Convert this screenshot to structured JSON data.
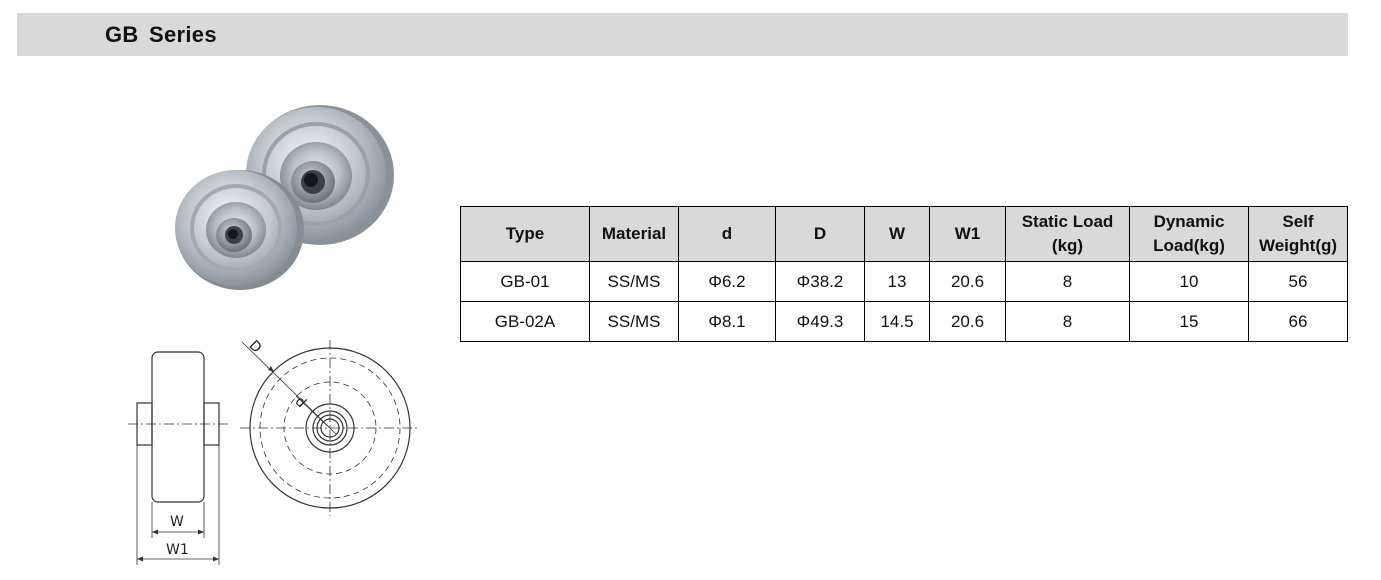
{
  "header": {
    "title": "GB  Series"
  },
  "drawing_labels": {
    "outer_diameter": "D",
    "bore": "d",
    "width": "W",
    "overall_width": "W1"
  },
  "table": {
    "headers": [
      [
        "Type"
      ],
      [
        "Material"
      ],
      [
        "d"
      ],
      [
        "D"
      ],
      [
        "W"
      ],
      [
        "W1"
      ],
      [
        "Static Load",
        "(kg)"
      ],
      [
        "Dynamic",
        "Load(kg)"
      ],
      [
        "Self",
        "Weight(g)"
      ]
    ],
    "rows": [
      [
        "GB-01",
        "SS/MS",
        "Φ6.2",
        "Φ38.2",
        "13",
        "20.6",
        "8",
        "10",
        "56"
      ],
      [
        "GB-02A",
        "SS/MS",
        "Φ8.1",
        "Φ49.3",
        "14.5",
        "20.6",
        "8",
        "15",
        "66"
      ]
    ]
  },
  "colors": {
    "header_bg": "#d9d9d9",
    "table_header_bg": "#d9d9d9",
    "border": "#000000"
  }
}
